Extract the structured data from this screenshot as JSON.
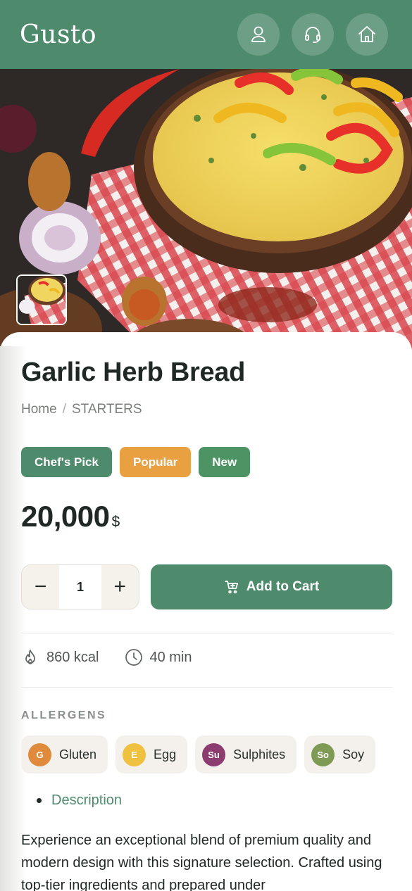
{
  "header": {
    "logo": "Gusto",
    "icons": [
      "user-icon",
      "headset-icon",
      "home-icon"
    ]
  },
  "hero": {
    "image": "spaghetti-with-peppers",
    "thumbnail": "spaghetti-thumbnail"
  },
  "product": {
    "title": "Garlic Herb Bread",
    "breadcrumb": {
      "home": "Home",
      "separator": "/",
      "category": "STARTERS"
    },
    "badges": [
      {
        "label": "Chef's Pick",
        "color": "#4e8a6c"
      },
      {
        "label": "Popular",
        "color": "#e8a040"
      },
      {
        "label": "New",
        "color": "#4c9463"
      }
    ],
    "price": {
      "amount": "20,000",
      "currency": "$"
    },
    "quantity": {
      "value": "1",
      "minus": "−",
      "plus": "+"
    },
    "add_to_cart": "Add to Cart",
    "meta": {
      "calories": "860 kcal",
      "time": "40 min"
    },
    "allergens_title": "ALLERGENS",
    "allergens": [
      {
        "code": "G",
        "label": "Gluten",
        "color": "#e08a3c"
      },
      {
        "code": "E",
        "label": "Egg",
        "color": "#f0c040"
      },
      {
        "code": "Su",
        "label": "Sulphites",
        "color": "#8c3c6e"
      },
      {
        "code": "So",
        "label": "Soy",
        "color": "#7e9a54"
      }
    ],
    "description_tab": "Description",
    "description": "Experience an exceptional blend of premium quality and modern design with this signature selection. Crafted using top-tier ingredients and prepared under"
  },
  "colors": {
    "primary": "#4e8a6c",
    "accent": "#e8a040",
    "text": "#1f2824"
  }
}
